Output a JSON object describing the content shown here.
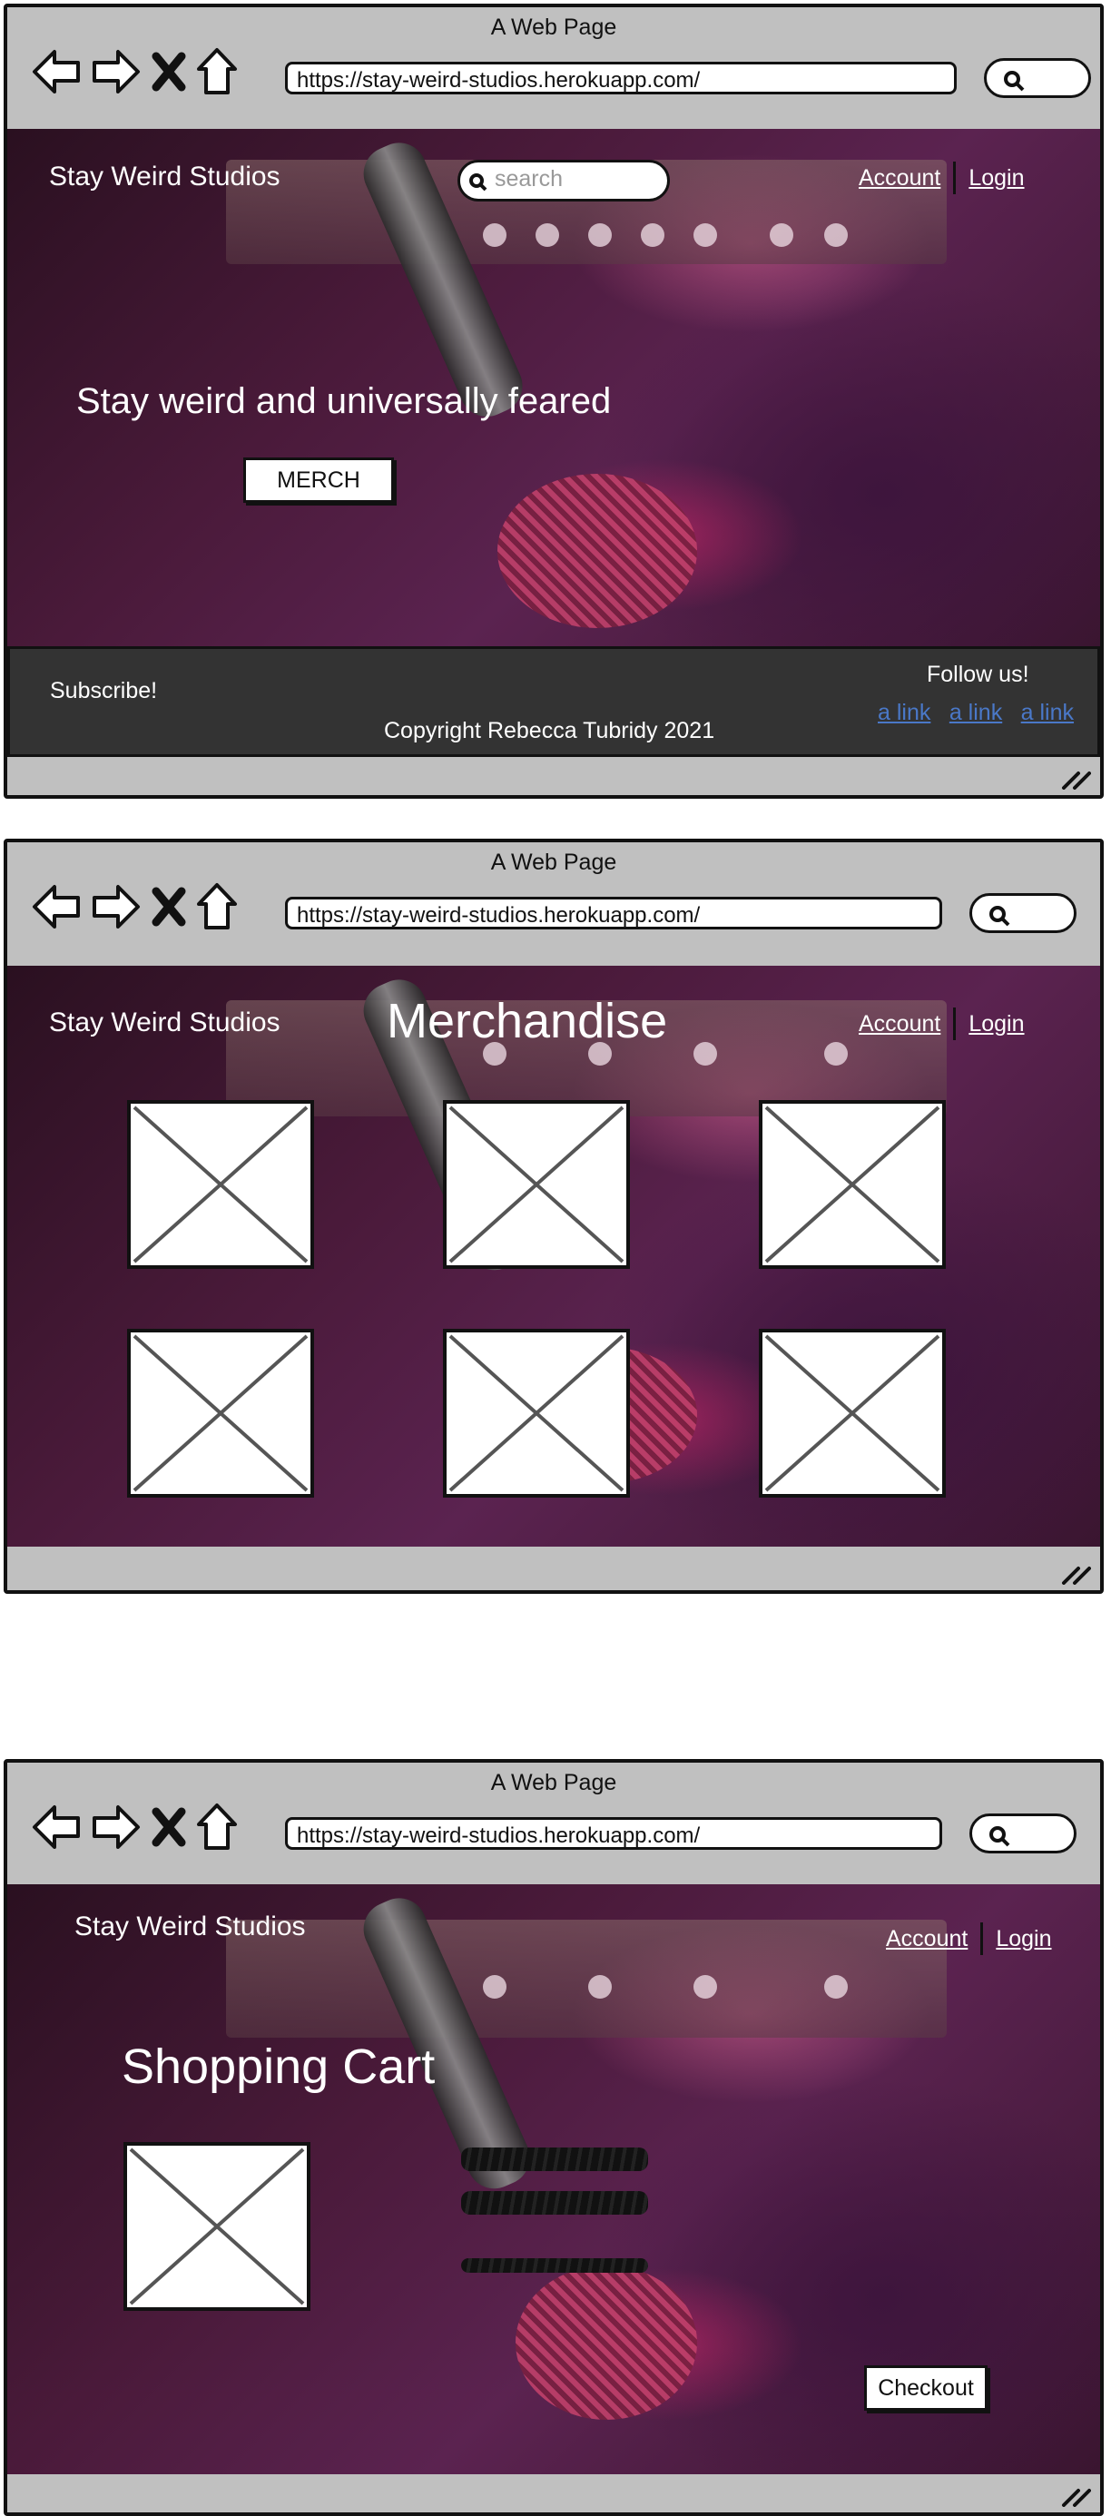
{
  "browser": {
    "window_title": "A Web Page",
    "url": "https://stay-weird-studios.herokuapp.com/",
    "nav_icons": [
      "back-arrow-icon",
      "forward-arrow-icon",
      "stop-icon",
      "home-icon",
      "search-icon"
    ]
  },
  "site": {
    "brand": "Stay Weird Studios",
    "account_link": "Account",
    "login_link": "Login"
  },
  "home": {
    "search_placeholder": "search",
    "hero_text": "Stay weird and universally feared",
    "merch_button": "MERCH",
    "footer": {
      "subscribe": "Subscribe!",
      "follow": "Follow us!",
      "copyright": "Copyright Rebecca Tubridy 2021",
      "links": [
        "a link",
        "a link",
        "a link"
      ]
    }
  },
  "merch": {
    "title": "Merchandise",
    "product_count_label": ""
  },
  "cart": {
    "title": "Shopping Cart",
    "checkout_button": "Checkout"
  },
  "colors": {
    "chrome": "#c0c0c0",
    "footer_bg": "#333333",
    "link_blue": "#4a78c8"
  }
}
